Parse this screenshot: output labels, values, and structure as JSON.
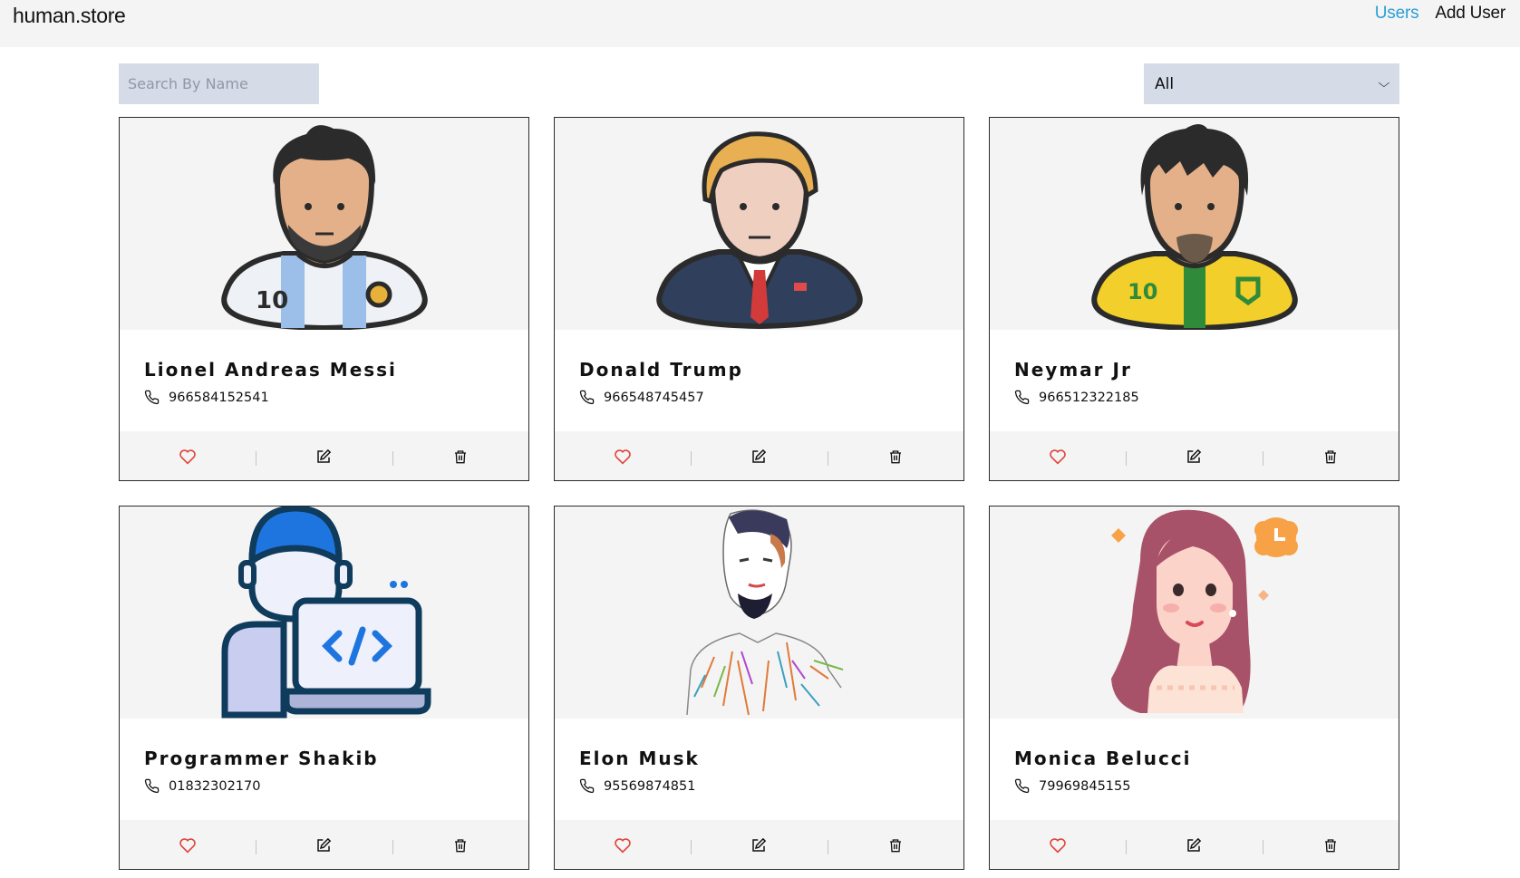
{
  "nav": {
    "brand": "human.store",
    "links": [
      {
        "label": "Users",
        "active": true
      },
      {
        "label": "Add User",
        "active": false
      }
    ]
  },
  "search": {
    "placeholder": "Search By Name",
    "value": ""
  },
  "filter": {
    "selected": "All"
  },
  "users": [
    {
      "name": "Lionel Andreas Messi",
      "phone": "966584152541",
      "avatar": "messi-avatar"
    },
    {
      "name": "Donald Trump",
      "phone": "966548745457",
      "avatar": "trump-avatar"
    },
    {
      "name": "Neymar Jr",
      "phone": "966512322185",
      "avatar": "neymar-avatar"
    },
    {
      "name": "Programmer Shakib",
      "phone": "01832302170",
      "avatar": "programmer-avatar"
    },
    {
      "name": "Elon Musk",
      "phone": "95569874851",
      "avatar": "elon-avatar"
    },
    {
      "name": "Monica Belucci",
      "phone": "79969845155",
      "avatar": "monica-avatar"
    }
  ],
  "icons": {
    "phone": "phone-icon",
    "favorite": "heart-icon",
    "edit": "edit-icon",
    "delete": "trash-icon"
  },
  "colors": {
    "active_link": "#2a9fd6",
    "heart": "#e0453a",
    "input_bg": "#d5dce7",
    "card_bg": "#f4f4f4"
  }
}
